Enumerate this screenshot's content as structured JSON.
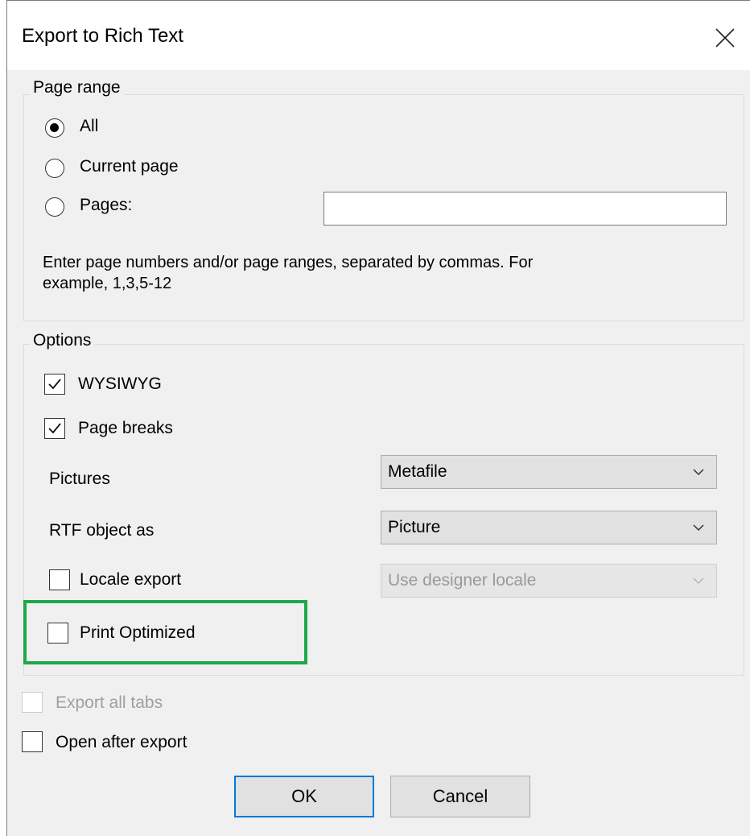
{
  "dialog": {
    "title": "Export to Rich Text"
  },
  "page_range": {
    "legend": "Page range",
    "options": [
      {
        "label": "All",
        "selected": true
      },
      {
        "label": "Current page",
        "selected": false
      },
      {
        "label": "Pages:",
        "selected": false
      }
    ],
    "pages_value": "",
    "hint_line1": "Enter page numbers and/or page ranges, separated by commas. For",
    "hint_line2": "example, 1,3,5-12"
  },
  "options": {
    "legend": "Options",
    "wysiwyg": {
      "label": "WYSIWYG",
      "checked": true
    },
    "page_breaks": {
      "label": "Page breaks",
      "checked": true
    },
    "pictures": {
      "label": "Pictures",
      "value": "Metafile"
    },
    "rtf_object": {
      "label": "RTF object as",
      "value": "Picture"
    },
    "locale_export": {
      "label": "Locale export",
      "checked": false,
      "value": "Use designer locale"
    },
    "print_optimized": {
      "label": "Print Optimized",
      "checked": false
    }
  },
  "export_all_tabs": {
    "label": "Export all tabs",
    "checked": false,
    "enabled": false
  },
  "open_after_export": {
    "label": "Open after export",
    "checked": false
  },
  "buttons": {
    "ok": "OK",
    "cancel": "Cancel"
  },
  "colors": {
    "highlight": "#1fa84a",
    "default_button_border": "#0078d7"
  }
}
